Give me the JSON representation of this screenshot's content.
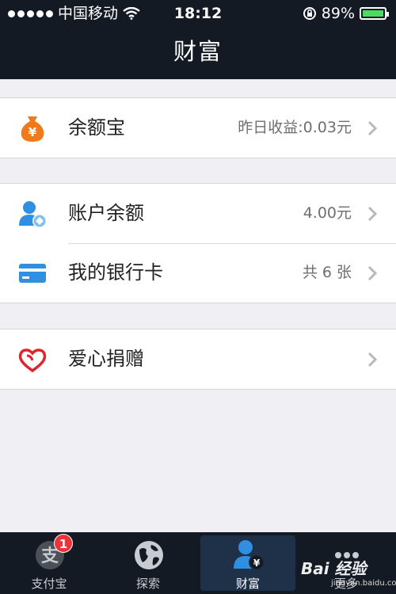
{
  "status_bar": {
    "carrier": "中国移动",
    "time": "18:12",
    "battery": "89%",
    "battery_level": 0.89
  },
  "nav": {
    "title": "财富"
  },
  "groups": [
    {
      "rows": [
        {
          "label": "余额宝",
          "value": "昨日收益:0.03元",
          "icon": "money-bag-icon"
        }
      ]
    },
    {
      "rows": [
        {
          "label": "账户余额",
          "value": "4.00元",
          "icon": "account-user-icon"
        },
        {
          "label": "我的银行卡",
          "value": "共 6 张",
          "icon": "bank-card-icon"
        }
      ]
    },
    {
      "rows": [
        {
          "label": "爱心捐赠",
          "value": "",
          "icon": "heart-icon"
        }
      ]
    }
  ],
  "tabbar": {
    "tabs": [
      {
        "label": "支付宝",
        "icon": "alipay-icon",
        "badge": "1"
      },
      {
        "label": "探索",
        "icon": "globe-icon"
      },
      {
        "label": "财富",
        "icon": "wealth-user-icon",
        "active": true
      },
      {
        "label": "更多",
        "icon": "more-icon"
      }
    ]
  },
  "watermark": {
    "brand": "Bai 经验",
    "url": "jingyan.baidu.com"
  },
  "colors": {
    "nav_bg": "#141a24",
    "page_bg": "#efeff4",
    "accent_blue": "#2f8fe0",
    "money_orange": "#f07a1a",
    "heart_red": "#e0242c",
    "badge_red": "#e8343a",
    "battery_green": "#4cd964"
  }
}
